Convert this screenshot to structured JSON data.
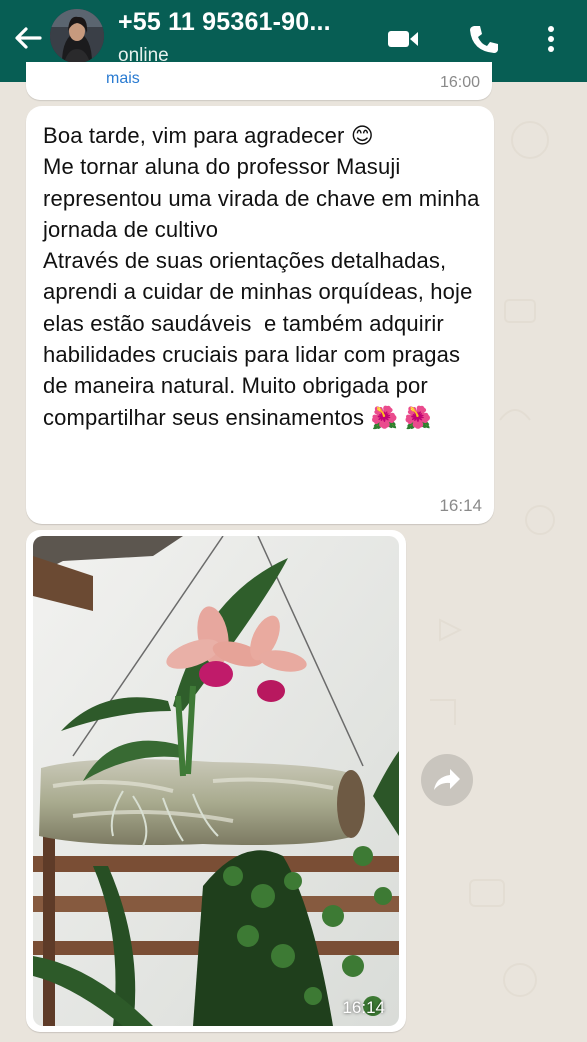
{
  "header": {
    "contact_name": "+55 11 95361-90...",
    "status": "online",
    "icons": [
      "back-arrow-icon",
      "avatar",
      "video-call-icon",
      "phone-call-icon",
      "more-options-icon"
    ],
    "color": "#075e54"
  },
  "previous_message": {
    "link_text": "mais",
    "time": "16:00"
  },
  "message": {
    "text": "Boa tarde, vim para agradecer 😊\nMe tornar aluna do professor Masuji representou uma virada de chave em minha jornada de cultivo\nAtravés de suas orientações detalhadas, aprendi a cuidar de minhas orquídeas, hoje elas estão saudáveis  e também adquirir habilidades cruciais para lidar com pragas de maneira natural. Muito obrigada por compartilhar seus ensinamentos 🌺 🌺",
    "time": "16:14"
  },
  "image_message": {
    "time": "16:14",
    "icon": "forward-icon"
  },
  "colors": {
    "chat_background": "#e9e4dc",
    "bubble": "#ffffff",
    "timestamp": "#8a8a8a"
  }
}
